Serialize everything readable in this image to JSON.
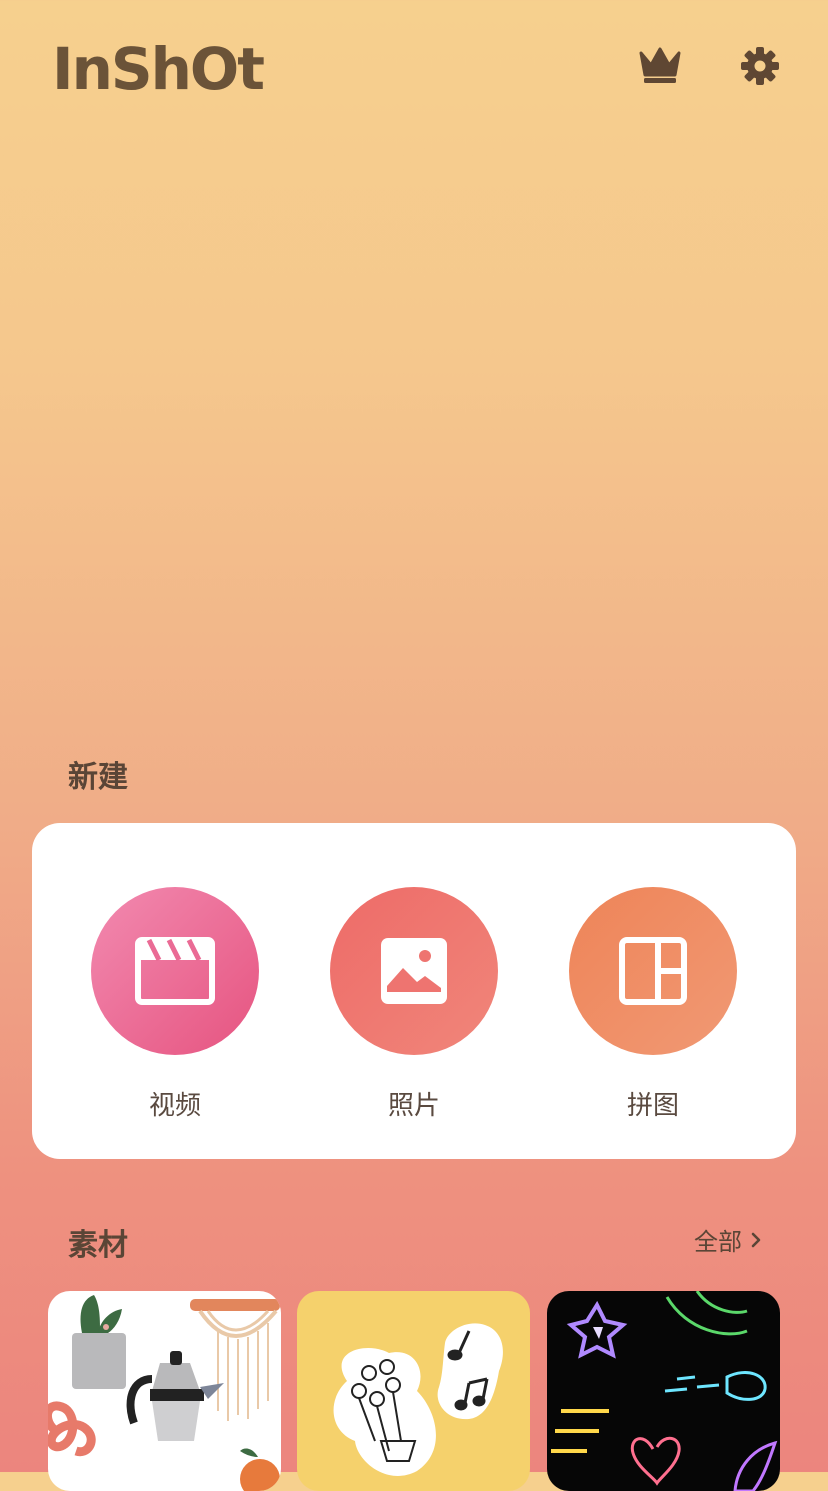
{
  "header": {
    "logo_text": "InShOt",
    "premium_icon": "crown-icon",
    "settings_icon": "gear-icon",
    "logo_color": "#6b5338"
  },
  "new_section": {
    "title": "新建",
    "actions": [
      {
        "label": "视频",
        "icon": "clapperboard-icon",
        "color": "#e96a92"
      },
      {
        "label": "照片",
        "icon": "image-icon",
        "color": "#ee7470"
      },
      {
        "label": "拼图",
        "icon": "collage-icon",
        "color": "#ef8c62"
      }
    ]
  },
  "assets_section": {
    "title": "素材",
    "all_label": "全部",
    "tiles": [
      {
        "name": "sticker-pack-illustrations",
        "background": "#ffffff"
      },
      {
        "name": "sticker-pack-doodles",
        "background": "#f5d16c"
      },
      {
        "name": "sticker-pack-neon",
        "background": "#060606"
      }
    ]
  }
}
